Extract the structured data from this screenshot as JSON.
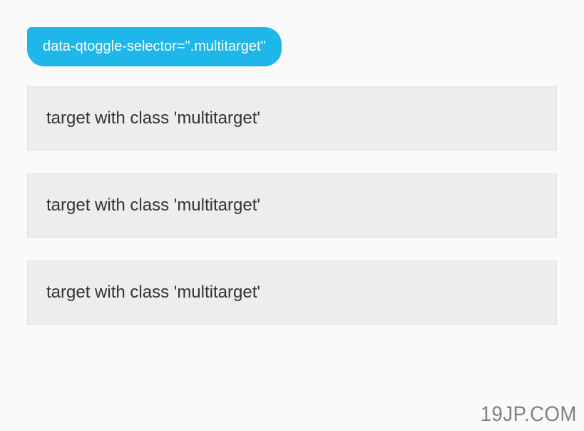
{
  "toggle_button": {
    "label": "data-qtoggle-selector=\".multitarget\""
  },
  "targets": [
    {
      "label": "target with class 'multitarget'"
    },
    {
      "label": "target with class 'multitarget'"
    },
    {
      "label": "target with class 'multitarget'"
    }
  ],
  "watermark": "19JP.COM"
}
